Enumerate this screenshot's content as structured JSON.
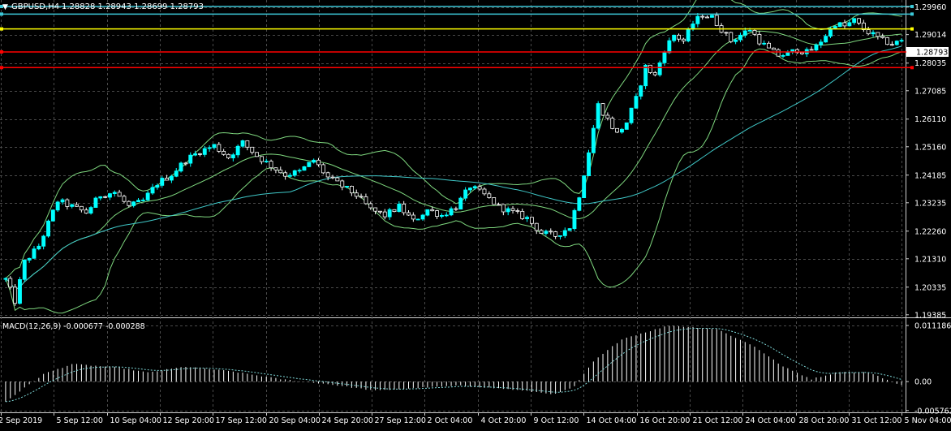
{
  "header": {
    "menu_glyph": "▼",
    "symbol": "GBPUSD,H4",
    "ohlc": "1.28828 1.28943 1.28699 1.28793"
  },
  "colors": {
    "background": "#000000",
    "grid": "#4a4a4a",
    "candle_up": "#00ffff",
    "candle_down": "#ffffff",
    "bands": "#7fd87f",
    "moving_average": "#3fc8c8",
    "hline_cyan": "#3cc8d8",
    "hline_yellow": "#ffff00",
    "hline_red": "#ff0000",
    "macd_histogram": "#ffffff",
    "macd_signal": "#7fd8d8",
    "axis_text": "#ffffff"
  },
  "price_axis": {
    "ticks": [
      "1.29960",
      "1.29014",
      "1.28035",
      "1.27085",
      "1.26110",
      "1.25160",
      "1.24185",
      "1.23235",
      "1.22260",
      "1.21310",
      "1.20335",
      "1.19385"
    ],
    "current_price_label": "1.28793"
  },
  "levels": [
    {
      "price": 1.2998,
      "color": "cyan"
    },
    {
      "price": 1.2972,
      "color": "cyan"
    },
    {
      "price": 1.2921,
      "color": "yellow"
    },
    {
      "price": 1.2842,
      "color": "red"
    },
    {
      "price": 1.2788,
      "color": "red"
    }
  ],
  "macd": {
    "title": "MACD(12,26,9) -0.000677 -0.000288",
    "ticks": [
      "0.011186",
      "0.00",
      "-0.005762"
    ]
  },
  "time_axis": {
    "labels": [
      "2 Sep 2019",
      "5 Sep 12:00",
      "10 Sep 04:00",
      "12 Sep 20:00",
      "17 Sep 12:00",
      "20 Sep 04:00",
      "24 Sep 20:00",
      "27 Sep 12:00",
      "2 Oct 04:00",
      "4 Oct 20:00",
      "9 Oct 12:00",
      "14 Oct 04:00",
      "16 Oct 20:00",
      "21 Oct 12:00",
      "24 Oct 04:00",
      "28 Oct 20:00",
      "31 Oct 12:00",
      "5 Nov 04:00"
    ]
  },
  "chart_data": {
    "type": "candlestick",
    "symbol": "GBPUSD",
    "timeframe": "H4",
    "ylim": [
      1.1938,
      1.3012
    ],
    "close_path": [
      [
        0,
        1.206
      ],
      [
        2,
        1.1985
      ],
      [
        4,
        1.212
      ],
      [
        7,
        1.2175
      ],
      [
        11,
        1.233
      ],
      [
        14,
        1.231
      ],
      [
        17,
        1.229
      ],
      [
        20,
        1.235
      ],
      [
        23,
        1.236
      ],
      [
        26,
        1.231
      ],
      [
        29,
        1.233
      ],
      [
        32,
        1.239
      ],
      [
        35,
        1.242
      ],
      [
        38,
        1.247
      ],
      [
        41,
        1.25
      ],
      [
        44,
        1.252
      ],
      [
        47,
        1.248
      ],
      [
        50,
        1.253
      ],
      [
        53,
        1.2485
      ],
      [
        56,
        1.245
      ],
      [
        59,
        1.242
      ],
      [
        62,
        1.243
      ],
      [
        65,
        1.247
      ],
      [
        68,
        1.241
      ],
      [
        71,
        1.238
      ],
      [
        74,
        1.235
      ],
      [
        77,
        1.23
      ],
      [
        80,
        1.228
      ],
      [
        83,
        1.231
      ],
      [
        86,
        1.226
      ],
      [
        89,
        1.23
      ],
      [
        92,
        1.228
      ],
      [
        95,
        1.231
      ],
      [
        98,
        1.238
      ],
      [
        101,
        1.235
      ],
      [
        104,
        1.231
      ],
      [
        107,
        1.229
      ],
      [
        110,
        1.227
      ],
      [
        113,
        1.222
      ],
      [
        116,
        1.221
      ],
      [
        119,
        1.224
      ],
      [
        121,
        1.235
      ],
      [
        123,
        1.25
      ],
      [
        125,
        1.266
      ],
      [
        127,
        1.261
      ],
      [
        129,
        1.256
      ],
      [
        131,
        1.26
      ],
      [
        133,
        1.268
      ],
      [
        135,
        1.279
      ],
      [
        137,
        1.276
      ],
      [
        139,
        1.285
      ],
      [
        141,
        1.29
      ],
      [
        143,
        1.288
      ],
      [
        145,
        1.294
      ],
      [
        147,
        1.297
      ],
      [
        149,
        1.296
      ],
      [
        151,
        1.292
      ],
      [
        153,
        1.288
      ],
      [
        155,
        1.29
      ],
      [
        157,
        1.292
      ],
      [
        159,
        1.288
      ],
      [
        161,
        1.285
      ],
      [
        163,
        1.283
      ],
      [
        165,
        1.2835
      ],
      [
        167,
        1.285
      ],
      [
        169,
        1.284
      ],
      [
        171,
        1.286
      ],
      [
        173,
        1.29
      ],
      [
        175,
        1.294
      ],
      [
        177,
        1.293
      ],
      [
        179,
        1.295
      ],
      [
        181,
        1.292
      ],
      [
        183,
        1.29
      ],
      [
        185,
        1.288
      ],
      [
        187,
        1.287
      ],
      [
        189,
        1.2879
      ]
    ],
    "macd_path": [
      [
        0,
        -0.004
      ],
      [
        8,
        0.0015
      ],
      [
        14,
        0.0035
      ],
      [
        24,
        0.0028
      ],
      [
        30,
        0.0018
      ],
      [
        38,
        0.003
      ],
      [
        48,
        0.002
      ],
      [
        58,
        0.0005
      ],
      [
        68,
        -0.0005
      ],
      [
        78,
        -0.0018
      ],
      [
        88,
        -0.0012
      ],
      [
        96,
        -0.0008
      ],
      [
        106,
        -0.0015
      ],
      [
        116,
        -0.0025
      ],
      [
        120,
        -0.001
      ],
      [
        124,
        0.004
      ],
      [
        130,
        0.0085
      ],
      [
        140,
        0.0112
      ],
      [
        150,
        0.0105
      ],
      [
        158,
        0.007
      ],
      [
        164,
        0.003
      ],
      [
        170,
        0.0005
      ],
      [
        176,
        0.002
      ],
      [
        182,
        0.0018
      ],
      [
        189,
        -0.0007
      ]
    ],
    "macd_ylim": [
      -0.0058,
      0.012
    ]
  }
}
